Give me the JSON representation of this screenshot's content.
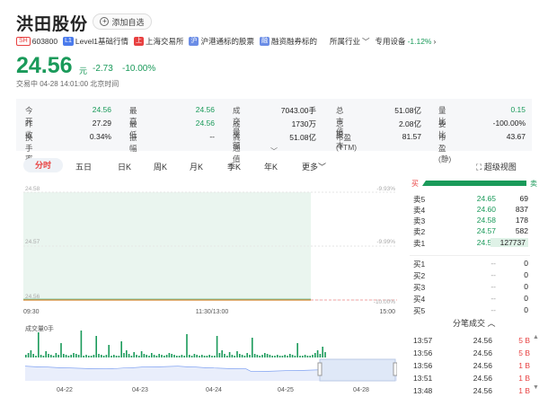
{
  "header": {
    "title": "洪田股份",
    "add_label": "添加自选",
    "exchange_badge": "SH",
    "code": "603800",
    "level1": "Level1基础行情",
    "sse": "上海交易所",
    "hk_connect": "沪港通标的股票",
    "margin": "融资融券标的",
    "industry_label": "所属行业",
    "industry": "专用设备",
    "industry_chg": "-1.12%"
  },
  "quote": {
    "price": "24.56",
    "currency": "元",
    "change": "-2.73",
    "change_pct": "-10.00%",
    "timestamp": "交易中 04-28 14:01:00 北京时间"
  },
  "stats": [
    [
      {
        "l": "今开",
        "v": "24.56",
        "c": "g"
      },
      {
        "l": "最高",
        "v": "24.56",
        "c": "g"
      },
      {
        "l": "成交量",
        "v": "7043.00手",
        "c": ""
      },
      {
        "l": "总市值",
        "v": "51.08亿",
        "c": ""
      },
      {
        "l": "量比",
        "v": "0.15",
        "c": "g"
      }
    ],
    [
      {
        "l": "昨收",
        "v": "27.29",
        "c": ""
      },
      {
        "l": "最低",
        "v": "24.56",
        "c": "g"
      },
      {
        "l": "成交额",
        "v": "1730万",
        "c": ""
      },
      {
        "l": "总股本",
        "v": "2.08亿",
        "c": ""
      },
      {
        "l": "委比",
        "v": "-100.00%",
        "c": ""
      }
    ],
    [
      {
        "l": "换手率",
        "v": "0.34%",
        "c": ""
      },
      {
        "l": "振幅",
        "v": "--",
        "c": ""
      },
      {
        "l": "流通值",
        "v": "51.08亿",
        "c": ""
      },
      {
        "l": "市盈(TTM)",
        "v": "81.57",
        "c": ""
      },
      {
        "l": "市盈(静)",
        "v": "43.67",
        "c": ""
      }
    ]
  ],
  "tabs": [
    "分时",
    "五日",
    "日K",
    "周K",
    "月K",
    "季K",
    "年K",
    "更多"
  ],
  "k_view": "超级视图",
  "chart": {
    "y_left": [
      "24.58",
      "24.57",
      "24.56"
    ],
    "y_right": [
      "-9.93%",
      "-9.99%",
      "-10.00%"
    ],
    "x_labels": [
      "09:30",
      "11:30/13:00",
      "15:00"
    ],
    "vol_label": "成交量0手",
    "nav_dates": [
      "04-22",
      "04-23",
      "04-24",
      "04-25",
      "04-28"
    ]
  },
  "book": {
    "asks": [
      {
        "l": "卖5",
        "p": "24.65",
        "v": "69"
      },
      {
        "l": "卖4",
        "p": "24.60",
        "v": "837"
      },
      {
        "l": "卖3",
        "p": "24.58",
        "v": "178"
      },
      {
        "l": "卖2",
        "p": "24.57",
        "v": "582"
      },
      {
        "l": "卖1",
        "p": "24.56",
        "v": "127737"
      }
    ],
    "bids": [
      {
        "l": "买1",
        "p": "--",
        "v": "0"
      },
      {
        "l": "买2",
        "p": "--",
        "v": "0"
      },
      {
        "l": "买3",
        "p": "--",
        "v": "0"
      },
      {
        "l": "买4",
        "p": "--",
        "v": "0"
      },
      {
        "l": "买5",
        "p": "--",
        "v": "0"
      }
    ],
    "buy_label": "买",
    "sell_label": "卖",
    "buy_ratio": 0.0
  },
  "trades_head": "分笔成交",
  "trades": [
    {
      "t": "13:57",
      "p": "24.56",
      "v": "5 B"
    },
    {
      "t": "13:56",
      "p": "24.56",
      "v": "5 B"
    },
    {
      "t": "13:56",
      "p": "24.56",
      "v": "1 B"
    },
    {
      "t": "13:51",
      "p": "24.56",
      "v": "1 B"
    },
    {
      "t": "13:48",
      "p": "24.56",
      "v": "1 B"
    }
  ],
  "colors": {
    "green": "#1a9a5a",
    "red": "#e84141",
    "blue": "#4b7bec"
  }
}
